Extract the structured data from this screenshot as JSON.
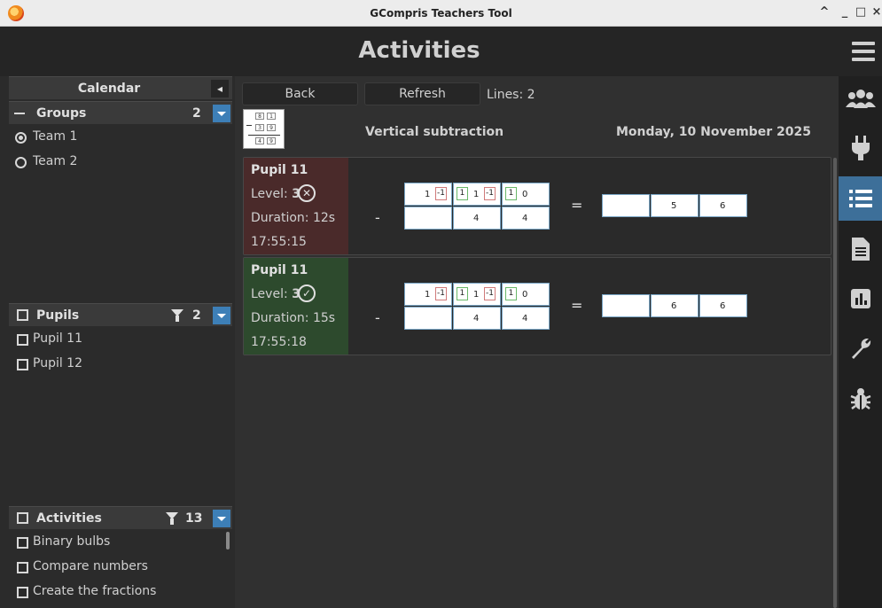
{
  "window": {
    "title": "GCompris Teachers Tool",
    "controls": [
      "^",
      "_",
      "□",
      "×"
    ]
  },
  "header": {
    "title": "Activities"
  },
  "rail": {
    "icons": [
      "hamburger-menu-icon",
      "users-icon",
      "plug-icon",
      "list-icon",
      "document-icon",
      "bar-chart-icon",
      "wrench-icon",
      "bug-icon"
    ],
    "active": "list-icon"
  },
  "calendar": {
    "label": "Calendar",
    "toggle": "◂"
  },
  "groups": {
    "label": "Groups",
    "count": "2",
    "items": [
      {
        "label": "Team 1",
        "selected": true
      },
      {
        "label": "Team 2",
        "selected": false
      }
    ]
  },
  "pupils": {
    "label": "Pupils",
    "count": "2",
    "items": [
      "Pupil 11",
      "Pupil 12"
    ]
  },
  "activities": {
    "label": "Activities",
    "count": "13",
    "items": [
      "Binary bulbs",
      "Compare numbers",
      "Create the fractions"
    ]
  },
  "toolbar": {
    "back": "Back",
    "refresh": "Refresh",
    "lines": "Lines: 2"
  },
  "activity": {
    "name": "Vertical subtraction",
    "date": "Monday, 10 November 2025",
    "icon_digits": [
      "8",
      "9",
      "1",
      "3",
      "9",
      "4",
      "9"
    ]
  },
  "results": [
    {
      "pupil": "Pupil 11",
      "level_label": "Level: ",
      "level": "3",
      "status": "fail",
      "duration": "Duration: 12s",
      "time": "17:55:15",
      "top_row": {
        "c1": "1",
        "c1_mini": "-1",
        "c2_mini_g": "1",
        "c2": "1",
        "c2_mini": "-1",
        "c3_mini_g": "1",
        "c3": "0"
      },
      "bottom_row": [
        "",
        "4",
        "4"
      ],
      "minus": "-",
      "equals": "=",
      "answer": [
        "",
        "5",
        "6"
      ]
    },
    {
      "pupil": "Pupil 11",
      "level_label": "Level: ",
      "level": "3",
      "status": "ok",
      "duration": "Duration: 15s",
      "time": "17:55:18",
      "top_row": {
        "c1": "1",
        "c1_mini": "-1",
        "c2_mini_g": "1",
        "c2": "1",
        "c2_mini": "-1",
        "c3_mini_g": "1",
        "c3": "0"
      },
      "bottom_row": [
        "",
        "4",
        "4"
      ],
      "minus": "-",
      "equals": "=",
      "answer": [
        "",
        "6",
        "6"
      ]
    }
  ],
  "colors": {
    "accent": "#3d7fb7",
    "fail_bg": "#4a2a2a",
    "ok_bg": "#2d4a2d"
  }
}
